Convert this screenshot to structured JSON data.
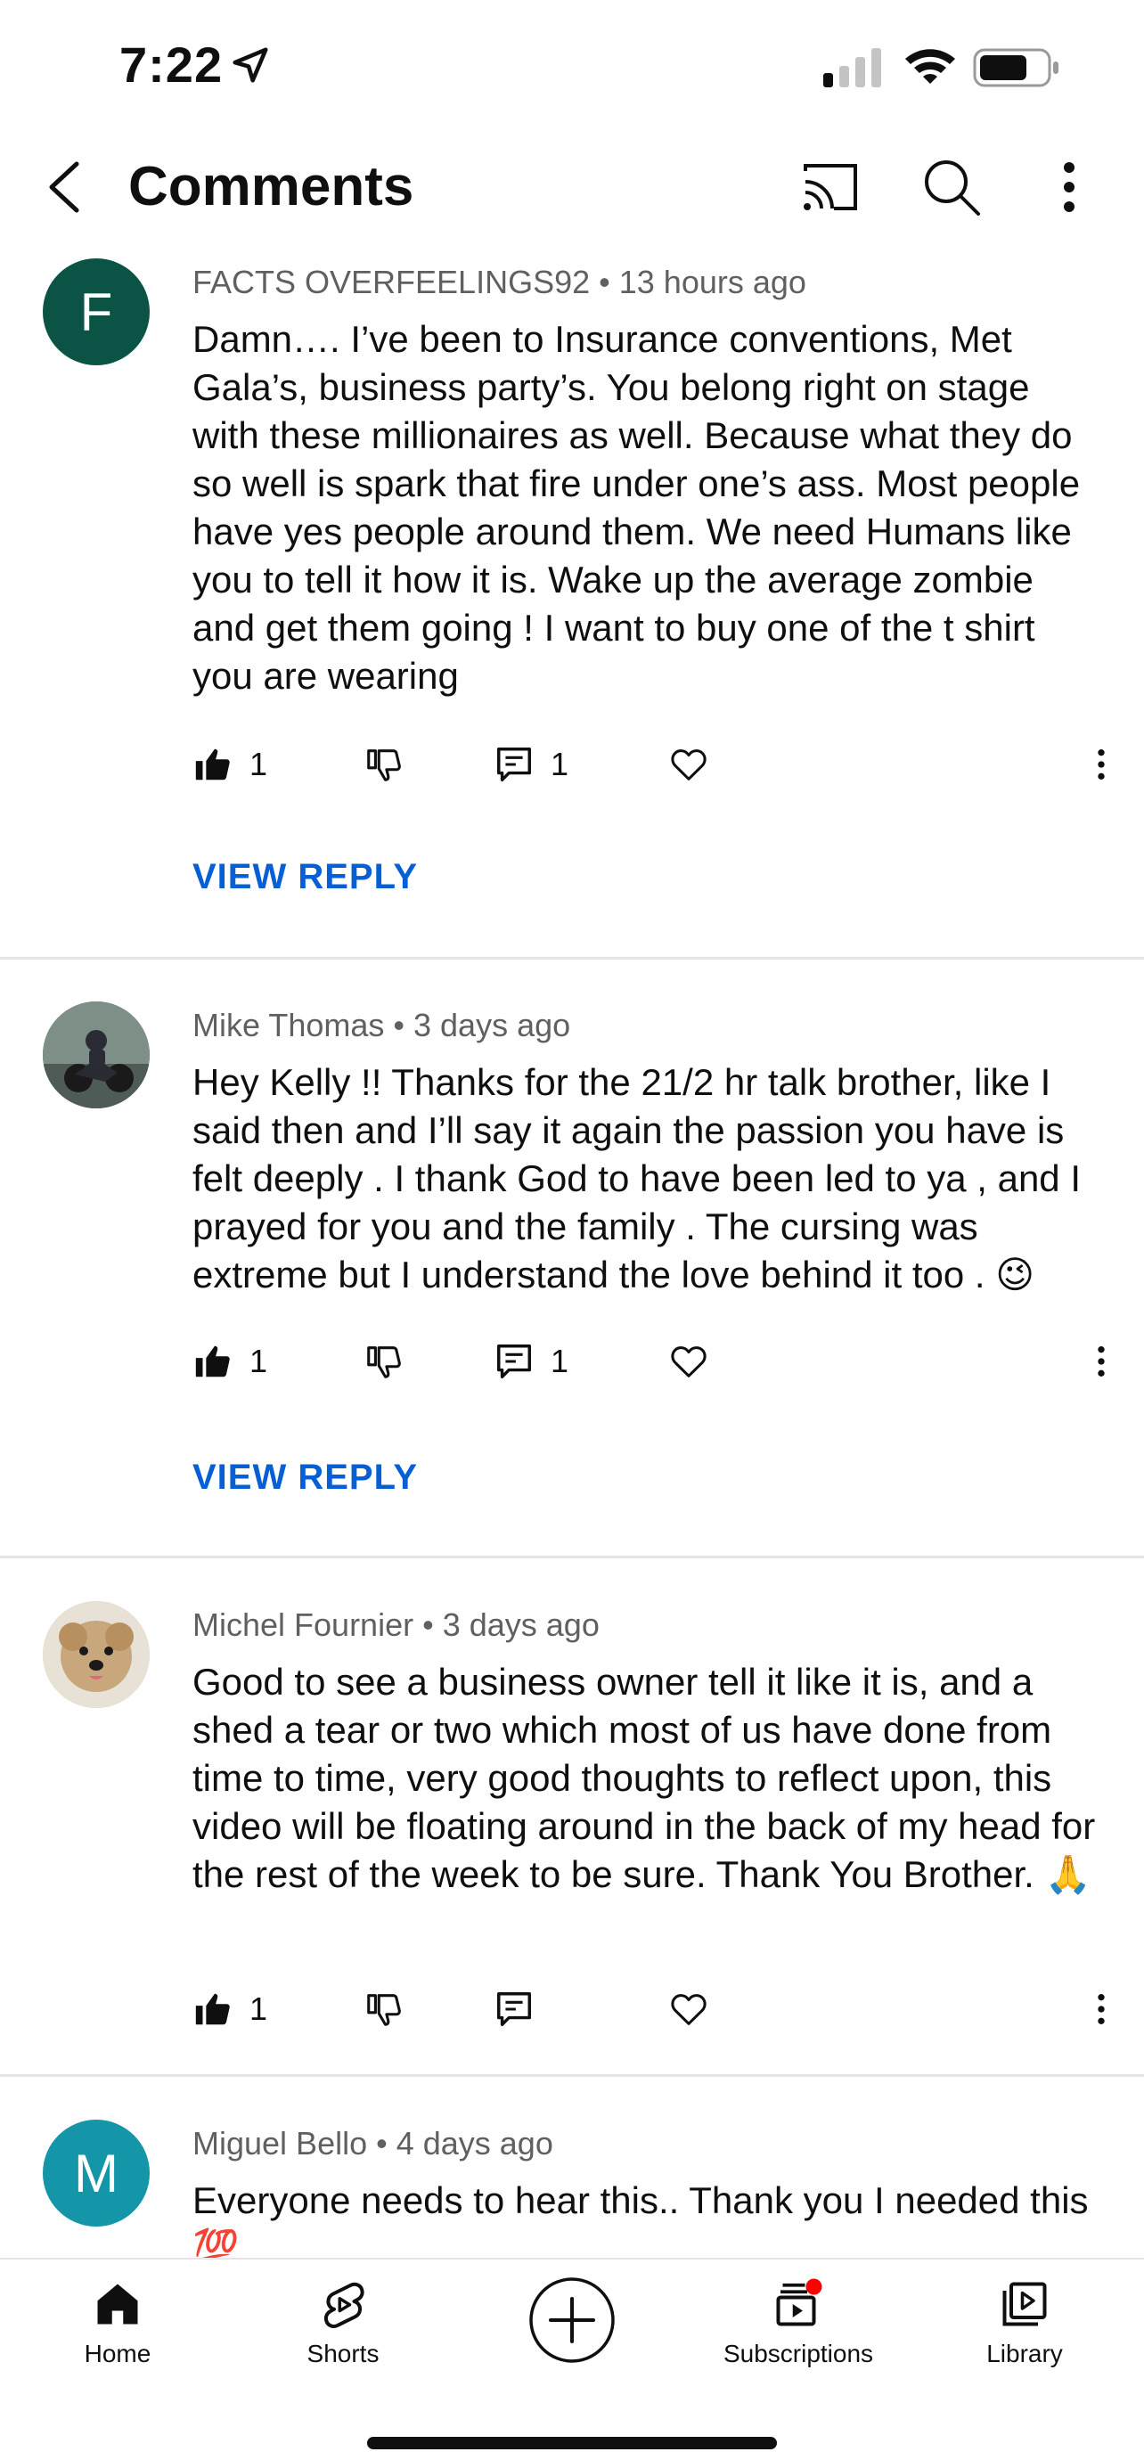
{
  "status_bar": {
    "time": "7:22"
  },
  "header": {
    "title": "Comments"
  },
  "comments": [
    {
      "author": "FACTS OVERFEELINGS92",
      "time": "13 hours ago",
      "avatar_letter": "F",
      "avatar_color": "#0b5345",
      "text": "Damn…. I’ve been to Insurance conventions, Met Gala’s, business party’s. You belong right on stage with these millionaires as well. Because what they do so well is spark that fire under one’s ass. Most people have yes people around them. We need Humans like you to tell it how it is. Wake up the average zombie and get them going ! I want to buy one of the t shirt you are wearing",
      "likes": "1",
      "replies": "1",
      "view_reply": "VIEW REPLY"
    },
    {
      "author": "Mike Thomas",
      "time": "3 days ago",
      "text": "Hey Kelly !! Thanks for the 21/2 hr talk brother, like I said then and I’ll say it again the passion you have is felt deeply . I thank God to have been led to ya , and I prayed for you and the family . The cursing was extreme but I understand the love behind it too . 😉",
      "likes": "1",
      "replies": "1",
      "view_reply": "VIEW REPLY"
    },
    {
      "author": "Michel Fournier",
      "time": "3 days ago",
      "text": "Good to see a business owner tell it like it is, and a shed a tear or two which most of us have done from time to time, very good thoughts to reflect upon, this video will be floating around in the back of my head for the rest of the week to be sure. Thank You Brother. 🙏",
      "likes": "1"
    },
    {
      "author": "Miguel Bello",
      "time": "4 days ago",
      "avatar_letter": "M",
      "avatar_color": "#1495a8",
      "text": "Everyone needs to hear this.. Thank you I needed this 💯"
    }
  ],
  "bottom_nav": {
    "home": "Home",
    "shorts": "Shorts",
    "subscriptions": "Subscriptions",
    "library": "Library",
    "notification_color": "#ff0000"
  },
  "colors": {
    "link_blue": "#065fd4",
    "text_secondary": "#606060"
  }
}
